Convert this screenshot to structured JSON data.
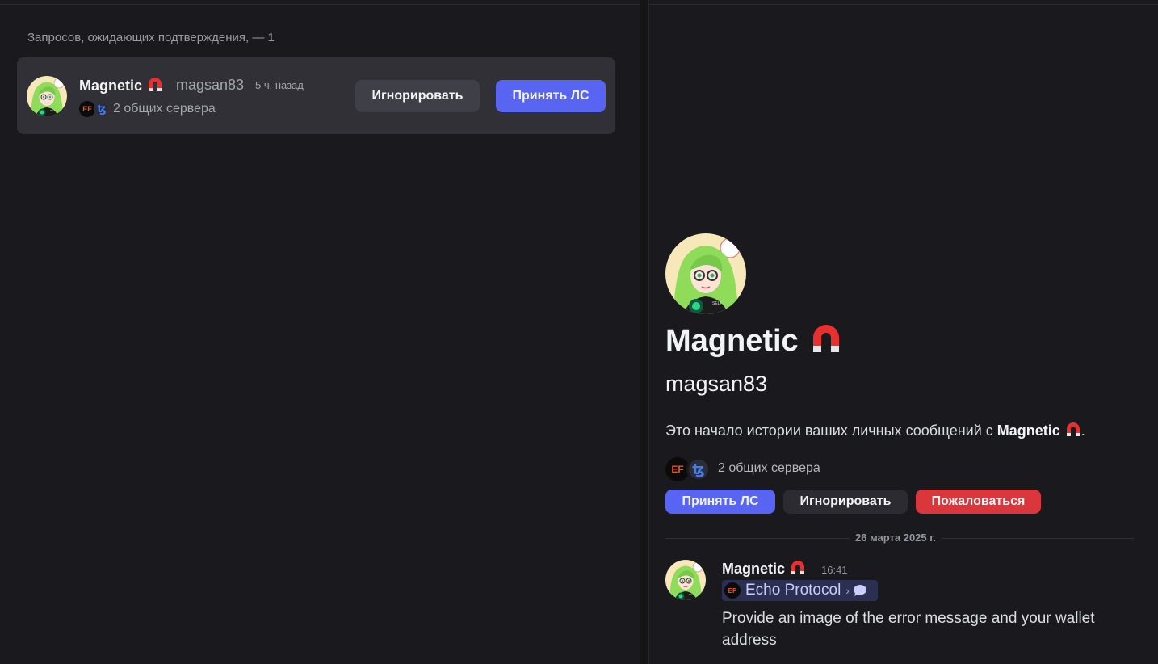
{
  "requests": {
    "section_title": "Запросов, ожидающих подтверждения, — 1",
    "items": [
      {
        "display_name": "Magnetic",
        "username": "magsan83",
        "time": "5 ч. назад",
        "servers_text": "2 общих сервера",
        "server_icons": [
          "EF",
          "ꜩ"
        ],
        "ignore_label": "Игнорировать",
        "accept_label": "Принять ЛС"
      }
    ]
  },
  "dm": {
    "display_name": "Magnetic",
    "username": "magsan83",
    "intro_prefix": "Это начало истории ваших личных сообщений с",
    "intro_name": "Magnetic",
    "intro_suffix": ".",
    "servers_text": "2 общих сервера",
    "server_icons": [
      "EF",
      "ꜩ"
    ],
    "accept_label": "Принять ЛС",
    "ignore_label": "Игнорировать",
    "report_label": "Пожаловаться",
    "date_divider": "26 марта 2025 г.",
    "message": {
      "author": "Magnetic",
      "time": "16:41",
      "server_tag": "Echo Protocol",
      "server_tag_icon": "EP",
      "text": "Provide an image of the error message and your wallet address"
    }
  },
  "colors": {
    "background": "#1a1a1e",
    "card": "#303036",
    "accent": "#5865f2",
    "danger": "#da373c",
    "avatar_hair": "#8fdc5a"
  },
  "icons": {
    "name_emoji": "magnet-icon",
    "tag_chevron": "chevron-right-icon",
    "tag_bubble": "chat-bubble-icon"
  }
}
